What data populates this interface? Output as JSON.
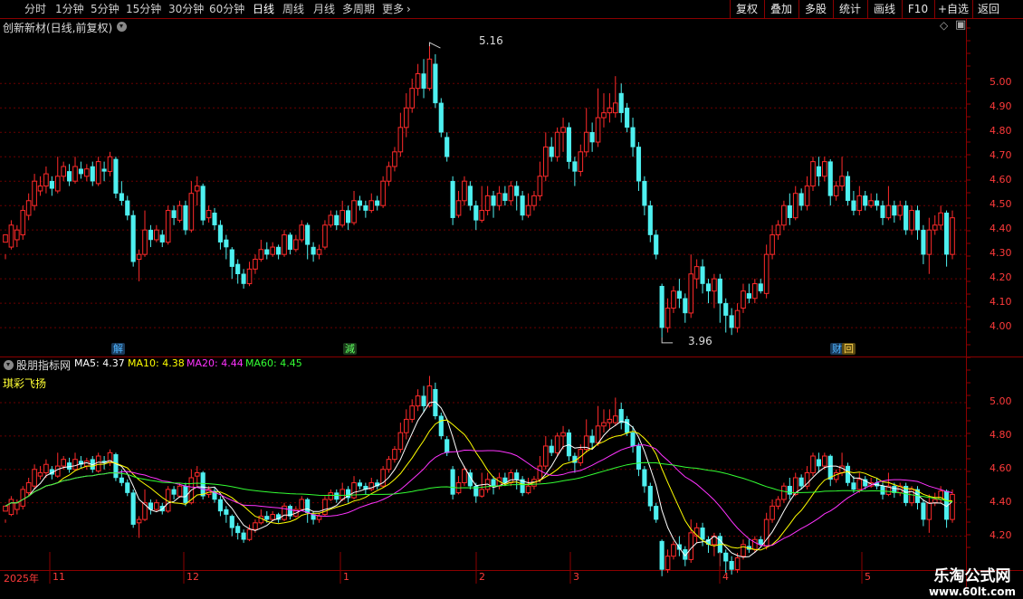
{
  "toolbar": {
    "periods": [
      "分时",
      "1分钟",
      "5分钟",
      "15分钟",
      "30分钟",
      "60分钟",
      "日线",
      "周线",
      "月线",
      "多周期",
      "更多"
    ],
    "active_period": "日线",
    "right_buttons": [
      "复权",
      "叠加",
      "多股",
      "统计",
      "画线",
      "F10",
      "+自选",
      "返回"
    ]
  },
  "main_panel": {
    "title": "创新新材(日线,前复权)",
    "high_label": "5.16",
    "low_label": "3.96",
    "y_ticks": [
      "5.00",
      "4.90",
      "4.80",
      "4.70",
      "4.60",
      "4.50",
      "4.40",
      "4.30",
      "4.20",
      "4.10",
      "4.00"
    ],
    "events": [
      {
        "text": "解",
        "color": "#4fb4ff"
      },
      {
        "text": "減",
        "color": "#5fff5f"
      },
      {
        "text": "财",
        "color": "#4fb4ff"
      },
      {
        "text": "回",
        "color": "#ffd24f"
      }
    ]
  },
  "indicator_panel": {
    "title": "股朋指标网",
    "ma_labels": [
      {
        "text": "MA5: 4.37",
        "color": "#ffffff"
      },
      {
        "text": "MA10: 4.38",
        "color": "#ffff00"
      },
      {
        "text": "MA20: 4.44",
        "color": "#ff33ff"
      },
      {
        "text": "MA60: 4.45",
        "color": "#33ff33"
      }
    ],
    "subtitle": "琪彩飞扬",
    "y_ticks": [
      "5.00",
      "4.80",
      "4.60",
      "4.40",
      "4.20"
    ]
  },
  "time_axis": {
    "labels": [
      "2025年",
      "11",
      "12",
      "1",
      "2",
      "3",
      "4",
      "5"
    ]
  },
  "watermark": {
    "line1": "乐淘公式网",
    "line2": "www.60lt.com"
  },
  "colors": {
    "up": "#ff2a2a",
    "down": "#4ef0f0",
    "grid": "#6a0000",
    "axis_text": "#ff3a3a",
    "border": "#8b0000"
  },
  "chart_data": {
    "type": "candlestick",
    "price_range": [
      3.93,
      5.19
    ],
    "candles": [
      [
        4.35,
        4.38,
        4.3,
        4.28
      ],
      [
        4.33,
        4.42,
        4.44,
        4.32
      ],
      [
        4.36,
        4.4,
        4.42,
        4.33
      ],
      [
        4.38,
        4.48,
        4.5,
        4.36
      ],
      [
        4.46,
        4.52,
        4.55,
        4.44
      ],
      [
        4.5,
        4.6,
        4.63,
        4.48
      ],
      [
        4.56,
        4.58,
        4.62,
        4.54
      ],
      [
        4.58,
        4.63,
        4.66,
        4.55
      ],
      [
        4.6,
        4.57,
        4.62,
        4.54
      ],
      [
        4.56,
        4.62,
        4.7,
        4.55
      ],
      [
        4.62,
        4.66,
        4.68,
        4.6
      ],
      [
        4.64,
        4.6,
        4.67,
        4.58
      ],
      [
        4.6,
        4.66,
        4.7,
        4.59
      ],
      [
        4.65,
        4.63,
        4.68,
        4.61
      ],
      [
        4.62,
        4.65,
        4.67,
        4.6
      ],
      [
        4.66,
        4.6,
        4.68,
        4.58
      ],
      [
        4.59,
        4.68,
        4.7,
        4.58
      ],
      [
        4.65,
        4.64,
        4.68,
        4.6
      ],
      [
        4.64,
        4.7,
        4.72,
        4.62
      ],
      [
        4.69,
        4.55,
        4.7,
        4.53
      ],
      [
        4.55,
        4.52,
        4.6,
        4.5
      ],
      [
        4.52,
        4.46,
        4.54,
        4.44
      ],
      [
        4.46,
        4.27,
        4.48,
        4.25
      ],
      [
        4.28,
        4.3,
        4.32,
        4.19
      ],
      [
        4.3,
        4.4,
        4.48,
        4.29
      ],
      [
        4.4,
        4.36,
        4.42,
        4.33
      ],
      [
        4.36,
        4.4,
        4.42,
        4.35
      ],
      [
        4.38,
        4.35,
        4.4,
        4.33
      ],
      [
        4.35,
        4.48,
        4.5,
        4.34
      ],
      [
        4.48,
        4.45,
        4.5,
        4.42
      ],
      [
        4.44,
        4.5,
        4.52,
        4.43
      ],
      [
        4.5,
        4.4,
        4.52,
        4.38
      ],
      [
        4.4,
        4.55,
        4.6,
        4.39
      ],
      [
        4.56,
        4.58,
        4.62,
        4.5
      ],
      [
        4.58,
        4.44,
        4.59,
        4.42
      ],
      [
        4.45,
        4.48,
        4.5,
        4.43
      ],
      [
        4.47,
        4.42,
        4.49,
        4.4
      ],
      [
        4.42,
        4.35,
        4.44,
        4.32
      ],
      [
        4.36,
        4.33,
        4.38,
        4.28
      ],
      [
        4.32,
        4.25,
        4.33,
        4.2
      ],
      [
        4.26,
        4.22,
        4.28,
        4.18
      ],
      [
        4.22,
        4.18,
        4.24,
        4.16
      ],
      [
        4.18,
        4.24,
        4.27,
        4.17
      ],
      [
        4.24,
        4.28,
        4.3,
        4.22
      ],
      [
        4.28,
        4.32,
        4.36,
        4.27
      ],
      [
        4.32,
        4.3,
        4.35,
        4.28
      ],
      [
        4.3,
        4.33,
        4.35,
        4.29
      ],
      [
        4.33,
        4.3,
        4.34,
        4.28
      ],
      [
        4.3,
        4.38,
        4.4,
        4.29
      ],
      [
        4.38,
        4.32,
        4.39,
        4.3
      ],
      [
        4.32,
        4.36,
        4.38,
        4.31
      ],
      [
        4.36,
        4.42,
        4.44,
        4.35
      ],
      [
        4.42,
        4.34,
        4.43,
        4.28
      ],
      [
        4.33,
        4.3,
        4.35,
        4.27
      ],
      [
        4.3,
        4.32,
        4.34,
        4.28
      ],
      [
        4.33,
        4.42,
        4.44,
        4.32
      ],
      [
        4.42,
        4.46,
        4.48,
        4.41
      ],
      [
        4.46,
        4.42,
        4.48,
        4.4
      ],
      [
        4.42,
        4.48,
        4.52,
        4.41
      ],
      [
        4.48,
        4.43,
        4.5,
        4.4
      ],
      [
        4.43,
        4.52,
        4.56,
        4.42
      ],
      [
        4.52,
        4.5,
        4.54,
        4.48
      ],
      [
        4.5,
        4.48,
        4.52,
        4.45
      ],
      [
        4.48,
        4.52,
        4.55,
        4.47
      ],
      [
        4.52,
        4.5,
        4.54,
        4.48
      ],
      [
        4.5,
        4.6,
        4.62,
        4.49
      ],
      [
        4.6,
        4.66,
        4.68,
        4.58
      ],
      [
        4.66,
        4.72,
        4.74,
        4.64
      ],
      [
        4.72,
        4.82,
        4.88,
        4.7
      ],
      [
        4.82,
        4.9,
        4.96,
        4.78
      ],
      [
        4.9,
        4.98,
        5.02,
        4.88
      ],
      [
        4.98,
        5.04,
        5.08,
        4.95
      ],
      [
        5.04,
        4.98,
        5.1,
        4.94
      ],
      [
        4.98,
        5.1,
        5.16,
        4.97
      ],
      [
        5.08,
        4.92,
        5.12,
        4.9
      ],
      [
        4.92,
        4.8,
        4.94,
        4.78
      ],
      [
        4.78,
        4.7,
        4.8,
        4.68
      ],
      [
        4.6,
        4.45,
        4.62,
        4.42
      ],
      [
        4.46,
        4.52,
        4.56,
        4.45
      ],
      [
        4.52,
        4.6,
        4.62,
        4.5
      ],
      [
        4.58,
        4.5,
        4.6,
        4.48
      ],
      [
        4.5,
        4.44,
        4.52,
        4.4
      ],
      [
        4.44,
        4.48,
        4.58,
        4.43
      ],
      [
        4.48,
        4.54,
        4.58,
        4.46
      ],
      [
        4.54,
        4.5,
        4.56,
        4.45
      ],
      [
        4.5,
        4.55,
        4.58,
        4.48
      ],
      [
        4.55,
        4.52,
        4.58,
        4.5
      ],
      [
        4.52,
        4.58,
        4.6,
        4.5
      ],
      [
        4.58,
        4.54,
        4.6,
        4.48
      ],
      [
        4.54,
        4.46,
        4.56,
        4.44
      ],
      [
        4.46,
        4.5,
        4.55,
        4.45
      ],
      [
        4.5,
        4.54,
        4.56,
        4.48
      ],
      [
        4.54,
        4.62,
        4.68,
        4.52
      ],
      [
        4.62,
        4.74,
        4.8,
        4.6
      ],
      [
        4.74,
        4.7,
        4.78,
        4.68
      ],
      [
        4.7,
        4.8,
        4.82,
        4.68
      ],
      [
        4.8,
        4.82,
        4.86,
        4.72
      ],
      [
        4.82,
        4.68,
        4.84,
        4.65
      ],
      [
        4.68,
        4.64,
        4.7,
        4.58
      ],
      [
        4.64,
        4.72,
        4.75,
        4.62
      ],
      [
        4.72,
        4.8,
        4.9,
        4.7
      ],
      [
        4.8,
        4.76,
        4.84,
        4.72
      ],
      [
        4.76,
        4.86,
        4.98,
        4.74
      ],
      [
        4.86,
        4.88,
        4.96,
        4.82
      ],
      [
        4.88,
        4.9,
        4.96,
        4.84
      ],
      [
        4.88,
        4.92,
        5.03,
        4.86
      ],
      [
        4.96,
        4.88,
        5.0,
        4.84
      ],
      [
        4.9,
        4.82,
        4.92,
        4.8
      ],
      [
        4.82,
        4.74,
        4.86,
        4.7
      ],
      [
        4.74,
        4.6,
        4.76,
        4.56
      ],
      [
        4.6,
        4.5,
        4.62,
        4.46
      ],
      [
        4.5,
        4.38,
        4.52,
        4.35
      ],
      [
        4.38,
        4.3,
        4.4,
        4.28
      ],
      [
        4.17,
        4.0,
        4.18,
        3.96
      ],
      [
        4.0,
        4.08,
        4.12,
        3.98
      ],
      [
        4.08,
        4.15,
        4.17,
        4.06
      ],
      [
        4.15,
        4.12,
        4.2,
        4.08
      ],
      [
        4.12,
        4.06,
        4.14,
        4.02
      ],
      [
        4.06,
        4.22,
        4.3,
        4.04
      ],
      [
        4.2,
        4.25,
        4.28,
        4.16
      ],
      [
        4.25,
        4.18,
        4.28,
        4.14
      ],
      [
        4.18,
        4.15,
        4.2,
        4.1
      ],
      [
        4.15,
        4.2,
        4.22,
        4.08
      ],
      [
        4.2,
        4.1,
        4.22,
        4.02
      ],
      [
        4.1,
        4.05,
        4.12,
        3.98
      ],
      [
        4.05,
        4.0,
        4.08,
        3.97
      ],
      [
        4.0,
        4.07,
        4.1,
        3.98
      ],
      [
        4.08,
        4.15,
        4.18,
        4.06
      ],
      [
        4.14,
        4.12,
        4.18,
        4.1
      ],
      [
        4.12,
        4.18,
        4.2,
        4.1
      ],
      [
        4.18,
        4.15,
        4.2,
        4.14
      ],
      [
        4.14,
        4.3,
        4.34,
        4.12
      ],
      [
        4.3,
        4.38,
        4.42,
        4.28
      ],
      [
        4.38,
        4.42,
        4.44,
        4.36
      ],
      [
        4.42,
        4.5,
        4.52,
        4.4
      ],
      [
        4.5,
        4.45,
        4.55,
        4.42
      ],
      [
        4.45,
        4.55,
        4.58,
        4.44
      ],
      [
        4.55,
        4.5,
        4.57,
        4.48
      ],
      [
        4.5,
        4.58,
        4.62,
        4.48
      ],
      [
        4.58,
        4.68,
        4.7,
        4.56
      ],
      [
        4.66,
        4.62,
        4.7,
        4.58
      ],
      [
        4.62,
        4.68,
        4.7,
        4.6
      ],
      [
        4.68,
        4.54,
        4.69,
        4.5
      ],
      [
        4.54,
        4.58,
        4.6,
        4.52
      ],
      [
        4.58,
        4.62,
        4.7,
        4.56
      ],
      [
        4.62,
        4.52,
        4.64,
        4.5
      ],
      [
        4.52,
        4.48,
        4.56,
        4.46
      ],
      [
        4.48,
        4.54,
        4.58,
        4.46
      ],
      [
        4.54,
        4.5,
        4.56,
        4.48
      ],
      [
        4.5,
        4.52,
        4.55,
        4.49
      ],
      [
        4.52,
        4.5,
        4.55,
        4.48
      ],
      [
        4.5,
        4.45,
        4.52,
        4.42
      ],
      [
        4.45,
        4.5,
        4.58,
        4.44
      ],
      [
        4.5,
        4.46,
        4.52,
        4.43
      ],
      [
        4.46,
        4.5,
        4.52,
        4.44
      ],
      [
        4.5,
        4.4,
        4.52,
        4.38
      ],
      [
        4.4,
        4.48,
        4.5,
        4.38
      ],
      [
        4.48,
        4.4,
        4.5,
        4.36
      ],
      [
        4.4,
        4.3,
        4.42,
        4.26
      ],
      [
        4.3,
        4.4,
        4.45,
        4.22
      ],
      [
        4.4,
        4.42,
        4.46,
        4.38
      ],
      [
        4.42,
        4.47,
        4.5,
        4.4
      ],
      [
        4.47,
        4.3,
        4.48,
        4.25
      ],
      [
        4.3,
        4.45,
        4.48,
        4.28
      ]
    ]
  }
}
